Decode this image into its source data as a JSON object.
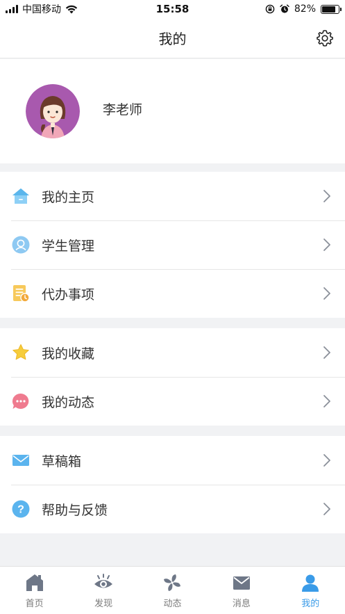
{
  "status_bar": {
    "carrier": "中国移动",
    "time": "15:58",
    "battery_percent": "82%",
    "battery_level": 0.82
  },
  "nav": {
    "title": "我的",
    "settings_icon": "gear-icon"
  },
  "profile": {
    "name": "李老师"
  },
  "groups": [
    {
      "items": [
        {
          "label": "我的主页",
          "icon": "home-icon"
        },
        {
          "label": "学生管理",
          "icon": "student-icon"
        },
        {
          "label": "代办事项",
          "icon": "todo-icon"
        }
      ]
    },
    {
      "items": [
        {
          "label": "我的收藏",
          "icon": "star-icon"
        },
        {
          "label": "我的动态",
          "icon": "chat-icon"
        }
      ]
    },
    {
      "items": [
        {
          "label": "草稿箱",
          "icon": "mail-icon"
        },
        {
          "label": "帮助与反馈",
          "icon": "help-icon"
        }
      ]
    }
  ],
  "tabs": [
    {
      "label": "首页",
      "icon": "home-tab-icon"
    },
    {
      "label": "发现",
      "icon": "eye-tab-icon"
    },
    {
      "label": "动态",
      "icon": "pinwheel-tab-icon"
    },
    {
      "label": "消息",
      "icon": "mail-tab-icon"
    },
    {
      "label": "我的",
      "icon": "person-tab-icon",
      "active": true
    }
  ],
  "colors": {
    "accent": "#3a9be8",
    "background": "#f1f2f4",
    "tab_inactive": "#7a7a7a",
    "tab_icon_inactive": "#6e7787"
  }
}
